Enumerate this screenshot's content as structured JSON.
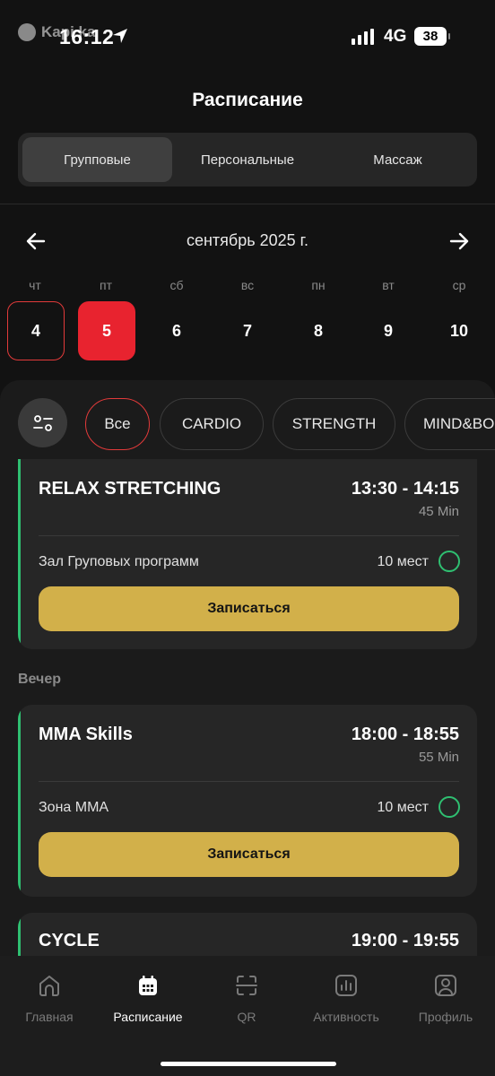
{
  "status_bar": {
    "time": "16:12",
    "network": "4G",
    "battery": "38",
    "watermark": "Kapi.ka"
  },
  "header": {
    "title": "Расписание"
  },
  "segments": [
    {
      "label": "Групповые",
      "active": true
    },
    {
      "label": "Персональные",
      "active": false
    },
    {
      "label": "Массаж",
      "active": false
    }
  ],
  "calendar": {
    "month": "сентябрь 2025 г.",
    "days": [
      {
        "name": "чт",
        "num": "4",
        "state": "today"
      },
      {
        "name": "пт",
        "num": "5",
        "state": "selected"
      },
      {
        "name": "сб",
        "num": "6",
        "state": ""
      },
      {
        "name": "вс",
        "num": "7",
        "state": ""
      },
      {
        "name": "пн",
        "num": "8",
        "state": ""
      },
      {
        "name": "вт",
        "num": "9",
        "state": ""
      },
      {
        "name": "ср",
        "num": "10",
        "state": ""
      }
    ]
  },
  "filters": [
    "Все",
    "CARDIO",
    "STRENGTH",
    "MIND&BODY"
  ],
  "classes": [
    {
      "title": "RELAX STRETCHING",
      "time": "13:30 - 14:15",
      "duration": "45 Min",
      "room": "Зал Груповых программ",
      "places": "10 мест",
      "button": "Записаться"
    },
    {
      "title": "MMA Skills",
      "time": "18:00 - 18:55",
      "duration": "55 Min",
      "room": "Зона ММА",
      "places": "10 мест",
      "button": "Записаться"
    },
    {
      "title": "CYCLE",
      "time": "19:00 - 19:55"
    }
  ],
  "sections": {
    "evening": "Вечер"
  },
  "tabbar": [
    {
      "label": "Главная",
      "icon": "home-icon"
    },
    {
      "label": "Расписание",
      "icon": "calendar-icon",
      "active": true
    },
    {
      "label": "QR",
      "icon": "qr-scan-icon"
    },
    {
      "label": "Активность",
      "icon": "activity-chart-icon"
    },
    {
      "label": "Профиль",
      "icon": "profile-icon"
    }
  ],
  "colors": {
    "accent_red": "#e8232f",
    "accent_green": "#2fbf71",
    "button_gold": "#d2b04a",
    "background": "#121212"
  }
}
